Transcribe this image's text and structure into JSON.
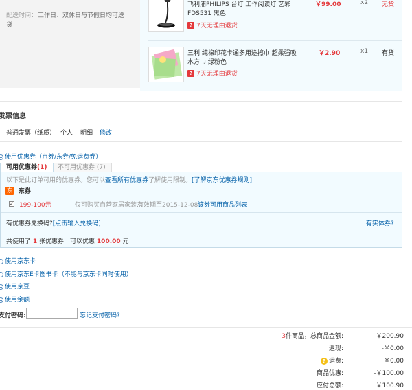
{
  "shipping": {
    "time_label": "配送时间：",
    "time_value_line1": "工作日、双休日与节假日均可送",
    "time_value_line2": "货"
  },
  "items": [
    {
      "title_line1": "飞利浦PHILIPS 台灯 工作阅读灯 艺彩",
      "title_line2": "FDS531 黑色",
      "return_policy": "7天无理由退货",
      "return_icon": "return-badge-icon",
      "price": "￥99.00",
      "qty": "x2",
      "stock": "无货"
    },
    {
      "title_line1": "三利 纯棉印花卡通多用途擦巾 超柔强吸",
      "title_line2": "水方巾 绿粉色",
      "return_policy": "7天无理由退货",
      "return_icon": "return-badge-icon",
      "price": "￥2.90",
      "qty": "x1",
      "stock": "有货"
    }
  ],
  "invoice": {
    "heading": "发票信息",
    "type": "普通发票（纸质）",
    "recipient": "个人",
    "content": "明细",
    "edit_link": "修改"
  },
  "coupon": {
    "toggle_label": "使用优惠券（京券/东券/免运费券）",
    "tabs": [
      {
        "label": "可用优惠券",
        "count": "(1)"
      },
      {
        "label": "不可用优惠券",
        "count": "(7)"
      }
    ],
    "info_prefix": "以下是此订单可用的优惠券。您可以",
    "info_link1": "查看所有优惠券",
    "info_mid": "了解使用限制。",
    "info_link2": "[了解京东优惠券规则]",
    "section_badge": "东",
    "section_name": "东券",
    "entry": {
      "checked_mark": "✓",
      "amount": "199-100元",
      "restriction": "仅可购买自营家居家装...",
      "expiry": "有效期至2015-12-08",
      "goods_link": "该券可用商品列表"
    },
    "exchange_prompt": "有优惠券兑换码?",
    "exchange_link": "[点击输入兑换码]",
    "physical_link": "有实体券?",
    "summary_prefix": "共使用了",
    "summary_count": "1",
    "summary_mid": "张优惠券　可以优惠",
    "summary_amount": "100.00",
    "summary_unit": "元"
  },
  "payment_options": [
    {
      "label": "使用京东卡"
    },
    {
      "label": "使用京东E卡图书卡（不能与京东卡同时使用）"
    },
    {
      "label": "使用京豆"
    },
    {
      "label": "使用余额"
    }
  ],
  "password": {
    "label": "支付密码:",
    "value": "",
    "forgot_link": "忘记支付密码?"
  },
  "totals": {
    "count": "3",
    "items_label": "件商品，总商品金额:",
    "items_value": "￥200.90",
    "rebate_label": "返现:",
    "rebate_value": "-￥0.00",
    "shipping_label": "运费:",
    "shipping_value": "￥0.00",
    "shipping_icon": "warning-icon",
    "discount_label": "商品优惠:",
    "discount_value": "-￥100.00",
    "due_label": "应付总额:",
    "due_value": "￥100.90"
  }
}
